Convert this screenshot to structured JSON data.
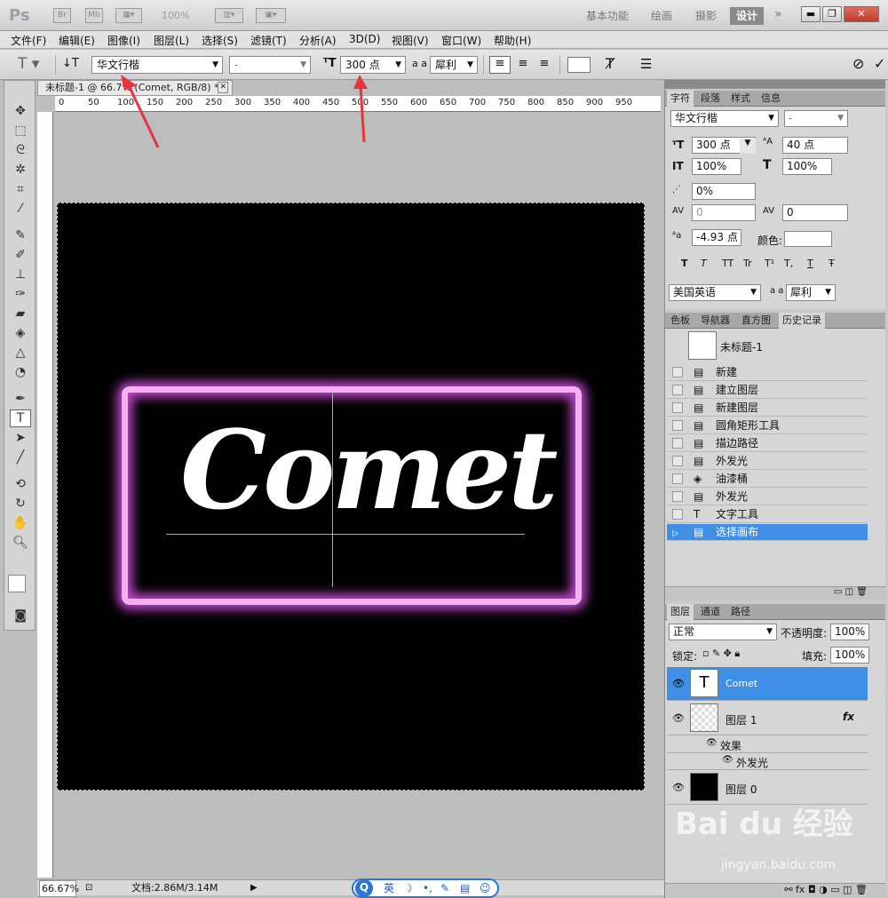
{
  "app": {
    "logo": "Ps",
    "br": "Br",
    "mb": "Mb",
    "zoom": "100%"
  },
  "workspaces": [
    "基本功能",
    "绘画",
    "摄影",
    "设计"
  ],
  "menus": [
    "文件(F)",
    "编辑(E)",
    "图像(I)",
    "图层(L)",
    "选择(S)",
    "滤镜(T)",
    "分析(A)",
    "3D(D)",
    "视图(V)",
    "窗口(W)",
    "帮助(H)"
  ],
  "options": {
    "font_family": "华文行楷",
    "font_style": "-",
    "font_size": "300 点",
    "aa_label": "a a",
    "antialias": "犀利"
  },
  "document": {
    "tab_title": "未标题-1 @ 66.7% (Comet, RGB/8) *",
    "text": "Comet",
    "zoom": "66.67%",
    "doc_info": "文档:2.86M/3.14M"
  },
  "ruler_ticks": [
    "0",
    "50",
    "100",
    "150",
    "200",
    "250",
    "300",
    "350",
    "400",
    "450",
    "500",
    "550",
    "600",
    "650",
    "700",
    "750",
    "800",
    "850",
    "900",
    "950"
  ],
  "char_panel": {
    "tabs": [
      "字符",
      "段落",
      "样式",
      "信息"
    ],
    "font_family": "华文行楷",
    "font_style": "-",
    "size": "300 点",
    "leading": "40 点",
    "vscale": "100%",
    "hscale": "100%",
    "tracking_pct": "0%",
    "kerning": "0",
    "tracking": "0",
    "baseline": "-4.93 点",
    "color_label": "颜色:",
    "language": "美国英语",
    "aa_label": "a a",
    "antialias": "犀利",
    "styles": [
      "T",
      "T",
      "TT",
      "Tr",
      "T¹",
      "T,",
      "T",
      "Ŧ"
    ]
  },
  "history_panel": {
    "tabs": [
      "色板",
      "导航器",
      "直方图",
      "历史记录"
    ],
    "snapshot": "未标题-1",
    "items": [
      {
        "icon": "doc",
        "label": "新建"
      },
      {
        "icon": "doc",
        "label": "建立图层"
      },
      {
        "icon": "doc",
        "label": "新建图层"
      },
      {
        "icon": "doc",
        "label": "圆角矩形工具"
      },
      {
        "icon": "doc",
        "label": "描边路径"
      },
      {
        "icon": "doc",
        "label": "外发光"
      },
      {
        "icon": "bucket",
        "label": "油漆桶"
      },
      {
        "icon": "doc",
        "label": "外发光"
      },
      {
        "icon": "T",
        "label": "文字工具"
      },
      {
        "icon": "doc",
        "label": "选择画布"
      }
    ]
  },
  "layers_panel": {
    "tabs": [
      "图层",
      "通道",
      "路径"
    ],
    "blend": "正常",
    "opacity_label": "不透明度:",
    "opacity": "100%",
    "lock_label": "锁定:",
    "fill_label": "填充:",
    "fill": "100%",
    "layers": [
      {
        "name": "Comet",
        "type": "text"
      },
      {
        "name": "图层 1",
        "fx": "fx",
        "effects_label": "效果",
        "effect": "外发光"
      },
      {
        "name": "图层 0",
        "type": "black"
      }
    ]
  },
  "watermark": {
    "brand": "Bai du 经验",
    "url": "jingyan.baidu.com"
  },
  "ime": {
    "label": "英"
  },
  "colors": {
    "selection": "#3f8fe6",
    "neon_border": "#f6b0f2",
    "neon_glow": "#c34bd0",
    "annotation_arrow": "#e8353d"
  }
}
